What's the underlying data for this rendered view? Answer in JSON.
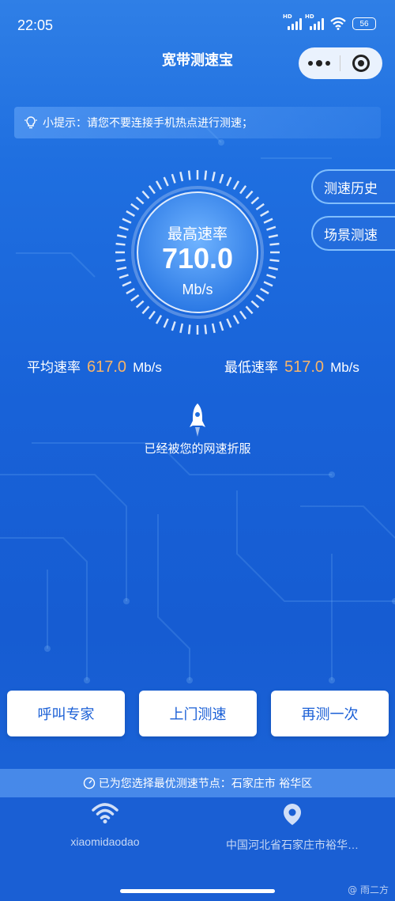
{
  "status": {
    "time": "22:05",
    "hd1": "HD",
    "hd2": "HD",
    "battery": "56"
  },
  "header": {
    "title": "宽带测速宝"
  },
  "tip": {
    "label": "小提示：",
    "text": "请您不要连接手机热点进行测速；"
  },
  "side": {
    "history": "测速历史",
    "scene": "场景测速"
  },
  "gauge": {
    "label": "最高速率",
    "value": "710.0",
    "unit": "Mb/s"
  },
  "stats": {
    "avg_label": "平均速率",
    "avg_value": "617.0",
    "avg_unit": "Mb/s",
    "min_label": "最低速率",
    "min_value": "517.0",
    "min_unit": "Mb/s"
  },
  "message": "已经被您的网速折服",
  "buttons": {
    "expert": "呼叫专家",
    "onsite": "上门测速",
    "retest": "再测一次"
  },
  "node": {
    "text": "已为您选择最优测速节点：石家庄市 裕华区"
  },
  "network": {
    "wifi_name": "xiaomidaodao",
    "location": "中国河北省石家庄市裕华…"
  },
  "watermark": "@ 雨二方",
  "colors": {
    "accent_orange": "#f6b46a",
    "button_text": "#1a5fd6"
  },
  "icons": {
    "tip": "lightbulb-icon",
    "wifi": "wifi-icon",
    "location": "location-pin-icon",
    "node": "speedometer-icon",
    "rocket": "rocket-icon"
  }
}
